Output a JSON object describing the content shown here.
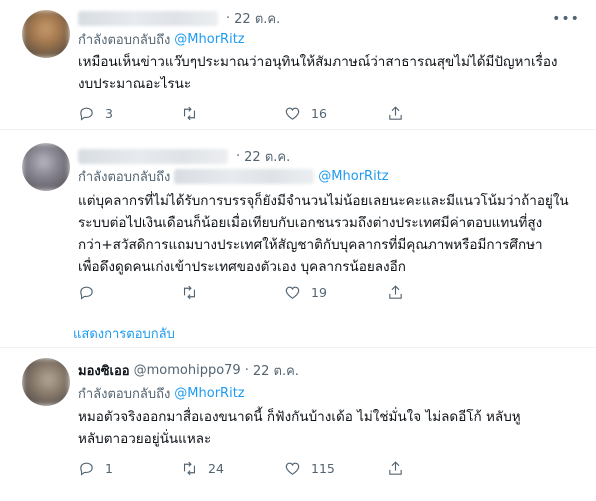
{
  "tweets": [
    {
      "name": "",
      "handle": "",
      "time": "22 ต.ค.",
      "replying_label": "กำลังตอบกลับถึง",
      "mention": "@MhorRitz",
      "lines": [
        "เหมือนเห็นข่าวแว๊บๆประมาณว่าอนุทินให้สัมภาษณ์ว่าสาธารณสุขไม่ได้มีปัญหาเรื่อง",
        "งบประมาณอะไรนะ"
      ],
      "reply_count": "3",
      "retweet_count": "",
      "like_count": "16"
    },
    {
      "name": "",
      "handle": "",
      "time": "22 ต.ค.",
      "replying_label": "กำลังตอบกลับถึง",
      "mention": "@MhorRitz",
      "lines": [
        "แต่บุคลากรที่ไม่ได้รับการบรรจุก็ยังมีจำนวนไม่น้อยเลยนะคะและมีแนวโน้มว่าถ้าอยู่ใน",
        "ระบบต่อไปเงินเดือนก็น้อยเมื่อเทียบกับเอกชนรวมถึงต่างประเทศมีค่าตอบแทนที่สูง",
        "กว่า+สวัสดิการแถมบางประเทศให้สัญชาติกับบุคลากรที่มีคุณภาพหรือมีการศึกษา",
        "เพื่อดึงดูดคนเก่งเข้าประเทศของตัวเอง  บุคลากรน้อยลงอีก"
      ],
      "reply_count": "",
      "retweet_count": "",
      "like_count": "19"
    },
    {
      "name": "มองซิเออ",
      "handle": "@momohippo79",
      "time": "22 ต.ค.",
      "replying_label": "กำลังตอบกลับถึง",
      "mention": "@MhorRitz",
      "lines": [
        "หมอตัวจริงออกมาสื่อเองขนาดนี้ ก็ฟังกันบ้างเด้อ ไม่ใช่มั่นใจ ไม่ลดอีโก้ หลับหู",
        "หลับตาอวยอยู่นั่นแหละ"
      ],
      "reply_count": "1",
      "retweet_count": "24",
      "like_count": "115"
    }
  ],
  "show_replies_label": "แสดงการตอบกลับ",
  "colors": {
    "accent": "#1d9bf0",
    "secondary_text": "#536471",
    "divider": "#eff3f4"
  },
  "icons": [
    "reply-icon",
    "retweet-icon",
    "like-icon",
    "share-icon",
    "more-icon"
  ]
}
